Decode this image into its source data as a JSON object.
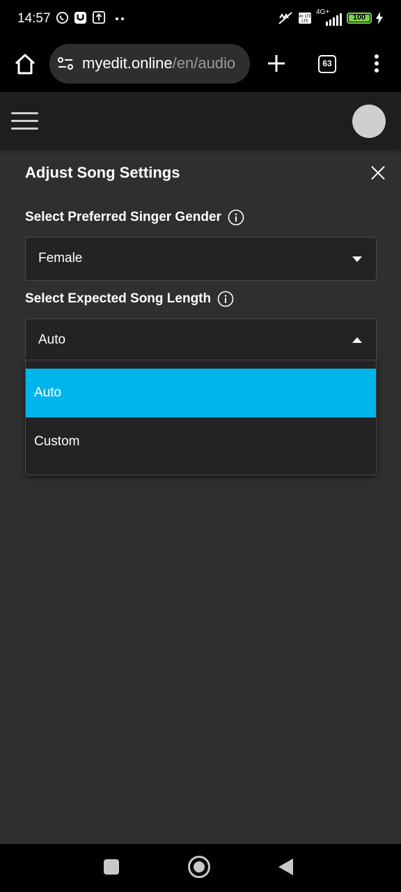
{
  "status_bar": {
    "time": "14:57",
    "network": "4G+",
    "volte": "Vo LTE",
    "battery": "100",
    "battery_fraction": 1.0,
    "icons": [
      "whatsapp-icon",
      "u-app-icon",
      "upload-icon",
      "more-dots-icon",
      "vibrate-off-icon",
      "signal-icon",
      "charging-icon"
    ]
  },
  "browser": {
    "url_host": "myedit.online",
    "url_path": "/en/audio",
    "tab_count": "63"
  },
  "panel": {
    "title": "Adjust Song Settings",
    "gender": {
      "label": "Select Preferred Singer Gender",
      "value": "Female"
    },
    "length": {
      "label": "Select Expected Song Length",
      "value": "Auto",
      "options": [
        "Auto",
        "Custom"
      ],
      "selected": "Auto"
    }
  },
  "colors": {
    "accent": "#00b5eb",
    "background": "#2f2f2f",
    "field": "#232325",
    "battery": "#7bd34f"
  }
}
